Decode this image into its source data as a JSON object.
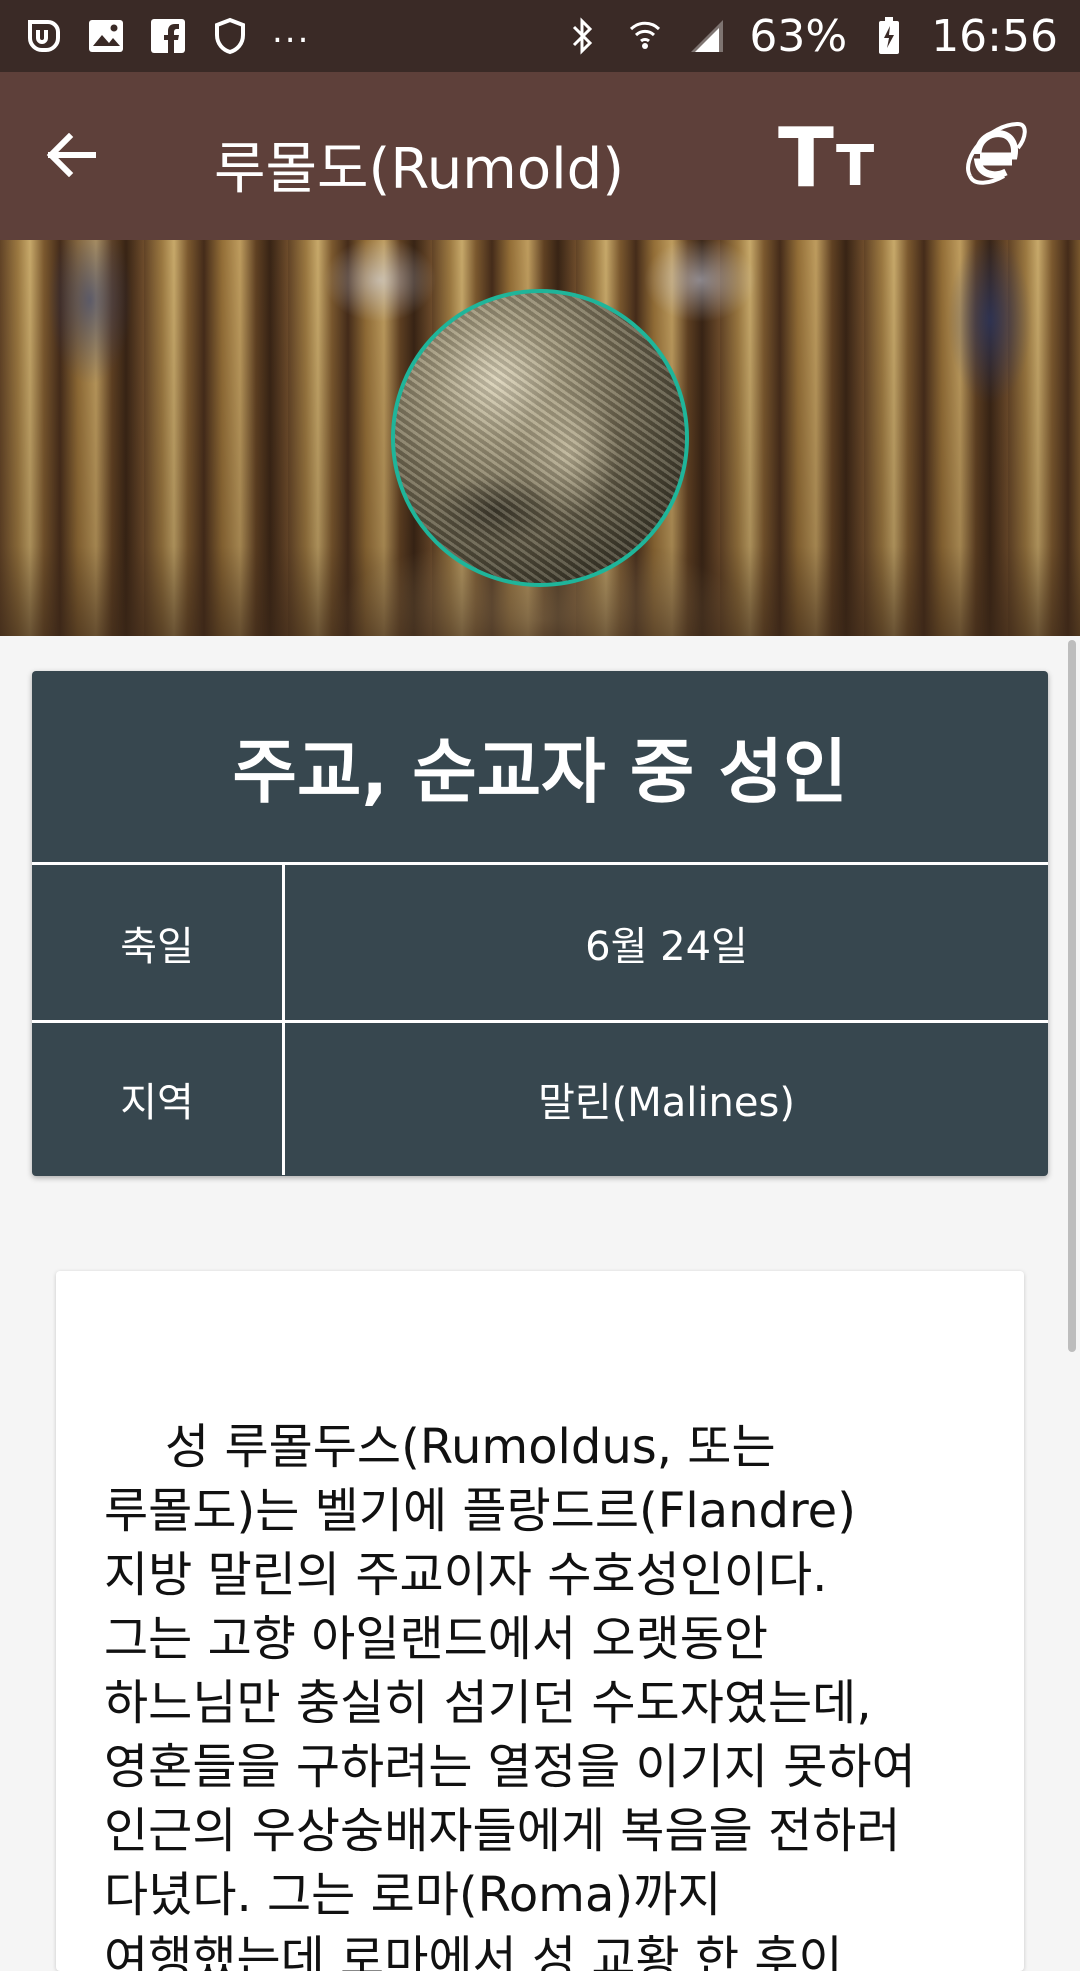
{
  "status_bar": {
    "left_icons": [
      "uplus-icon",
      "gallery-icon",
      "facebook-icon",
      "shield-icon"
    ],
    "more": "...",
    "right_icons": [
      "bluetooth-icon",
      "wifi-icon",
      "signal-icon"
    ],
    "battery_percent": "63%",
    "battery_icon": "battery-charging-icon",
    "time": "16:56"
  },
  "app_bar": {
    "back_icon": "arrow-back-icon",
    "title": "루몰도(Rumold)",
    "font_size_label_big": "T",
    "font_size_label_small": "T",
    "browser_icon": "internet-explorer-icon"
  },
  "hero": {
    "border_color": "#1fb59a"
  },
  "info": {
    "title": "주교, 순교자 중 성인",
    "rows": [
      {
        "label": "축일",
        "value": "6월 24일"
      },
      {
        "label": "지역",
        "value": "말린(Malines)"
      }
    ],
    "background": "#37474f"
  },
  "body_text": "    성 루몰두스(Rumoldus, 또는\n루몰도)는 벨기에 플랑드르(Flandre)\n지방 말린의 주교이자 수호성인이다.\n그는 고향 아일랜드에서 오랫동안\n하느님만 충실히 섬기던 수도자였는데,\n영혼들을 구하려는 열정을 이기지 못하여\n인근의 우상숭배자들에게 복음을 전하러\n다녔다. 그는 로마(Roma)까지\n여행했는데 로마에서 성 교황 한 후이",
  "colors": {
    "status_bar": "#3a2a26",
    "app_bar": "#5e403a",
    "page_background": "#f5f5f5"
  }
}
